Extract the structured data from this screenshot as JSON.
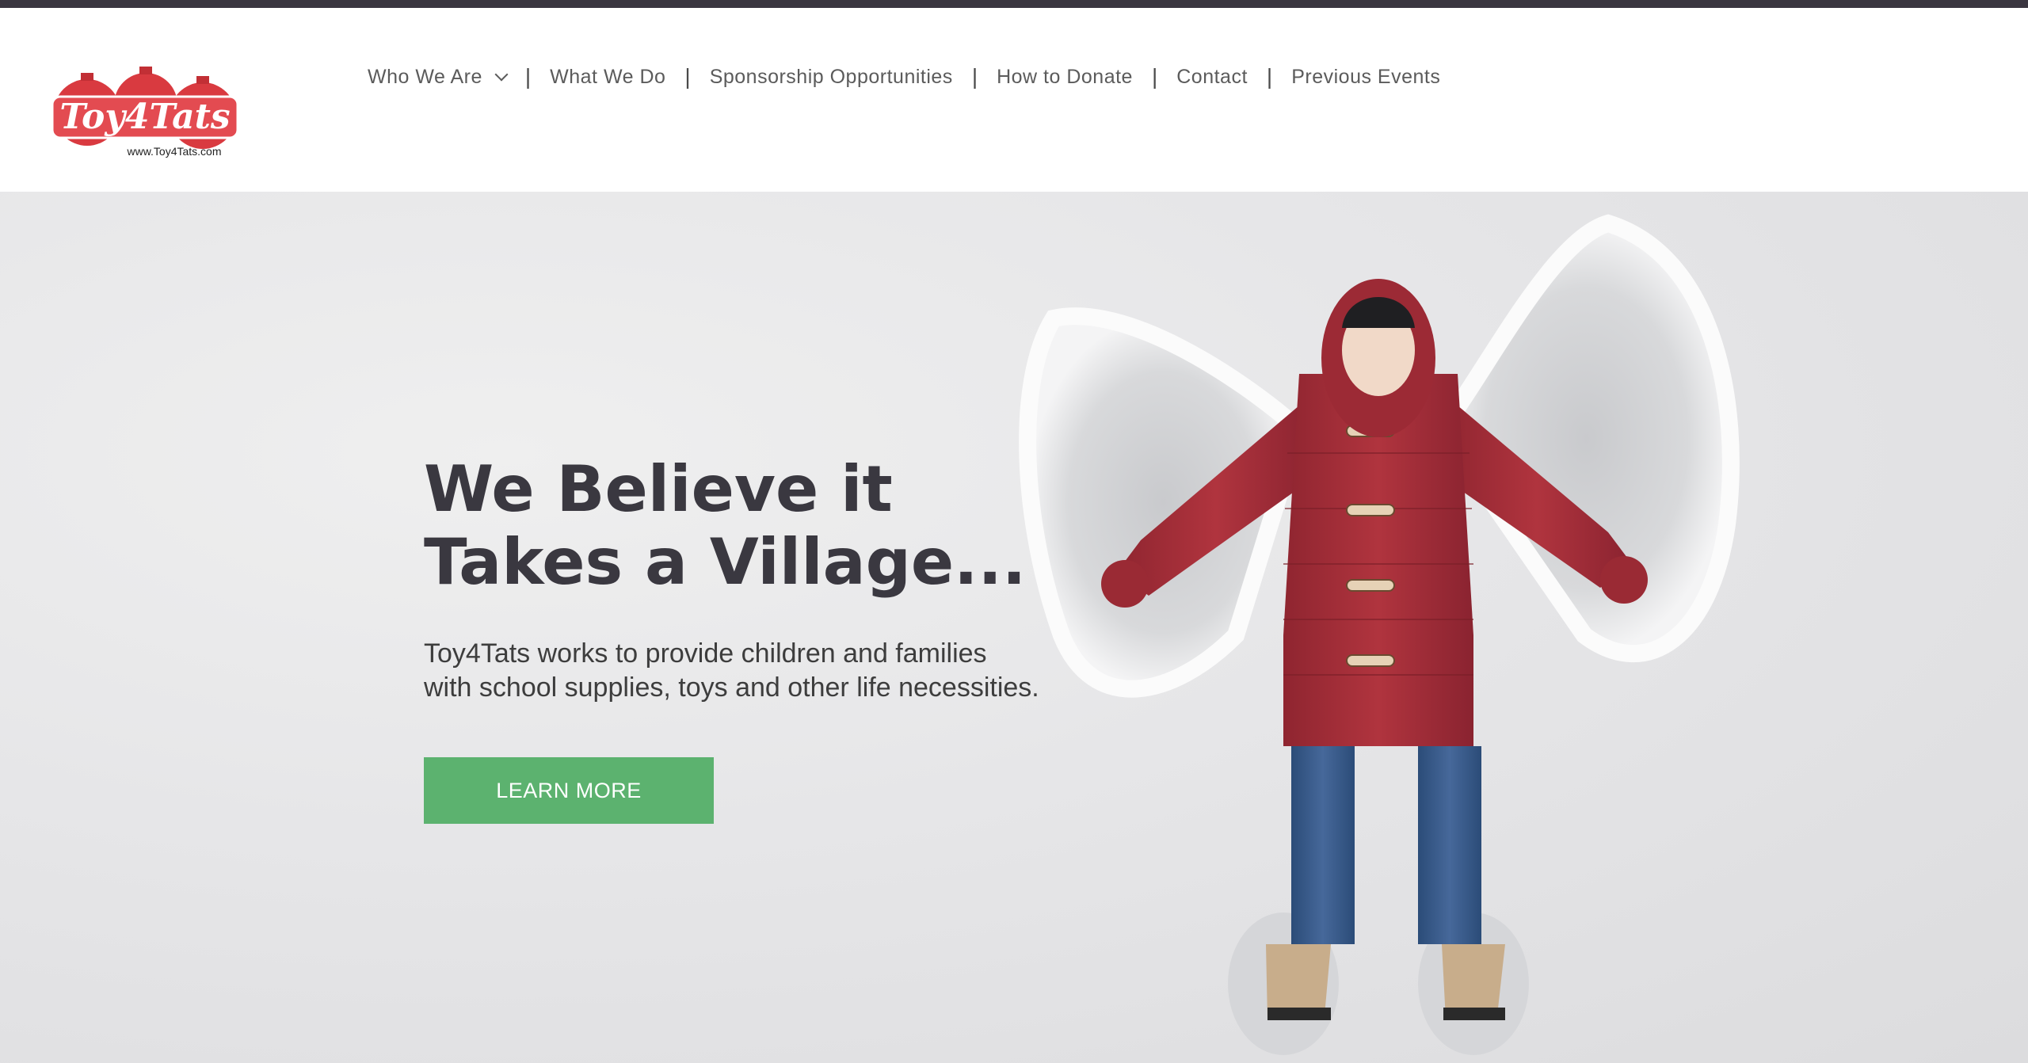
{
  "brand": {
    "logo_text": "Toy4Tats",
    "logo_url": "www.Toy4Tats.com",
    "logo_color": "#d93a40"
  },
  "nav": {
    "items": [
      {
        "label": "Who We Are",
        "has_dropdown": true
      },
      {
        "label": "What We Do"
      },
      {
        "label": "Sponsorship Opportunities"
      },
      {
        "label": "How to Donate"
      },
      {
        "label": "Contact"
      },
      {
        "label": "Previous Events"
      }
    ],
    "separator": "|"
  },
  "hero": {
    "headline_line1": "We Believe it",
    "headline_line2": "Takes a Village...",
    "subtext": "Toy4Tats works to provide children and families with school supplies, toys and other life necessities.",
    "cta_label": "LEARN MORE",
    "image_alt": "child in red coat making a snow angel"
  },
  "colors": {
    "topbar": "#3a3640",
    "cta": "#5cb26f",
    "headline": "#3a3840",
    "coat": "#a8303a"
  }
}
